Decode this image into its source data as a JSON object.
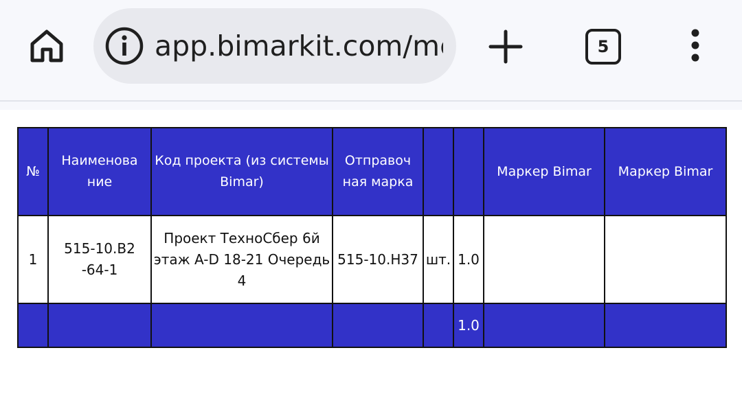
{
  "browser": {
    "url": "app.bimarkit.com/me",
    "tab_count": "5",
    "icons": {
      "home": "home-icon",
      "info": "info-icon",
      "new_tab": "plus-icon",
      "tabs": "tab-switcher-icon",
      "menu": "more-vert-icon"
    }
  },
  "table": {
    "headers": {
      "num": "№",
      "name": "Наименова ние",
      "project_code": "Код проекта (из системы Bimar)",
      "ship_mark": "Отправоч ная марка",
      "unit": "",
      "qty": "",
      "marker1": "Маркер Bimar",
      "marker2": "Маркер Bimar"
    },
    "row": {
      "num": "1",
      "name": "515-10.В2 -64-1",
      "project_code": "Проект ТехноСбер 6й этаж A-D 18-21 Очередь 4",
      "ship_mark": "515-10.Н37",
      "unit": "шт.",
      "qty": "1.0",
      "marker1": "",
      "marker2": ""
    },
    "total": {
      "qty": "1.0"
    }
  },
  "colors": {
    "header_bg": "#3232c8",
    "border": "#111111",
    "toolbar_bg": "#f7f8fc",
    "urlbar_bg": "#e8e9ee"
  }
}
